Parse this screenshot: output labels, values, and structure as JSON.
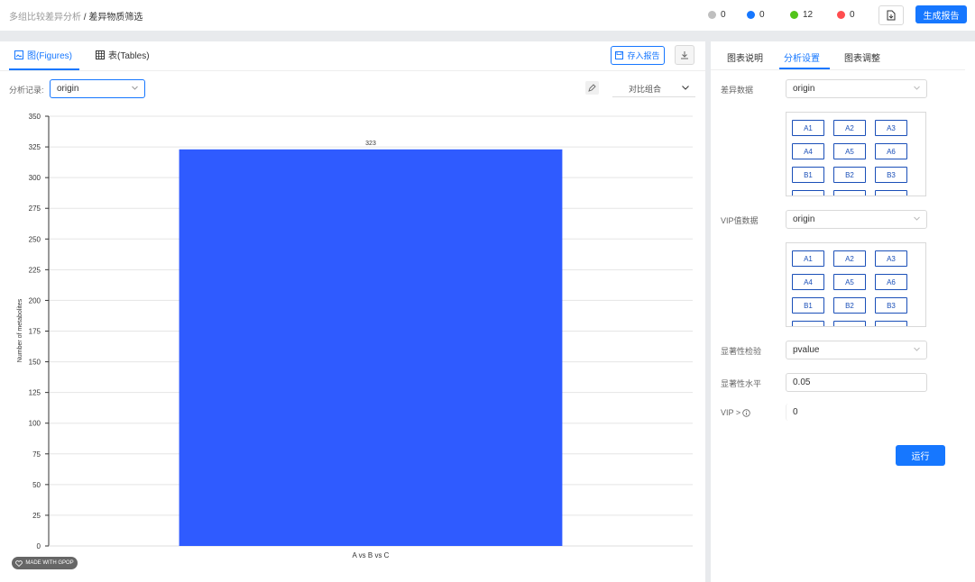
{
  "breadcrumb": {
    "parent": "多组比较差异分析",
    "separator": "/",
    "current": "差异物质筛选"
  },
  "status": [
    {
      "count": "0",
      "color": "#bfbfbf"
    },
    {
      "count": "0",
      "color": "#1677ff"
    },
    {
      "count": "12",
      "color": "#52c41a"
    },
    {
      "count": "0",
      "color": "#ff4d4f"
    }
  ],
  "header": {
    "report_button": "生成报告"
  },
  "left": {
    "tabs": [
      {
        "label": "图(Figures)"
      },
      {
        "label": "表(Tables)"
      }
    ],
    "save_report": "存入报告",
    "analysis_label": "分析记录:",
    "analysis_value": "origin",
    "group_value": "对比组合",
    "watermark": "MADE WITH GPOP"
  },
  "chart_data": {
    "type": "bar",
    "categories": [
      "A vs B vs C"
    ],
    "values": [
      323
    ],
    "data_labels": [
      "323"
    ],
    "ylabel": "Number of metabolites",
    "xlabel": "",
    "ylim": [
      0,
      350
    ],
    "yticks": [
      0,
      25,
      50,
      75,
      100,
      125,
      150,
      175,
      200,
      225,
      250,
      275,
      300,
      325,
      350
    ],
    "grid": true,
    "bar_color": "#2f5bff"
  },
  "right": {
    "tabs": [
      {
        "label": "图表说明"
      },
      {
        "label": "分析设置"
      },
      {
        "label": "图表调整"
      }
    ],
    "diff_data_label": "差异数据",
    "diff_data_value": "origin",
    "samples1": [
      "A1",
      "A2",
      "A3",
      "A4",
      "A5",
      "A6",
      "B1",
      "B2",
      "B3"
    ],
    "vip_data_label": "VIP值数据",
    "vip_data_value": "origin",
    "samples2": [
      "A1",
      "A2",
      "A3",
      "A4",
      "A5",
      "A6",
      "B1",
      "B2",
      "B3"
    ],
    "sig_test_label": "显著性检验",
    "sig_test_value": "pvalue",
    "sig_level_label": "显著性水平",
    "sig_level_value": "0.05",
    "vip_label": "VIP >",
    "vip_value": "0",
    "run_button": "运行"
  }
}
